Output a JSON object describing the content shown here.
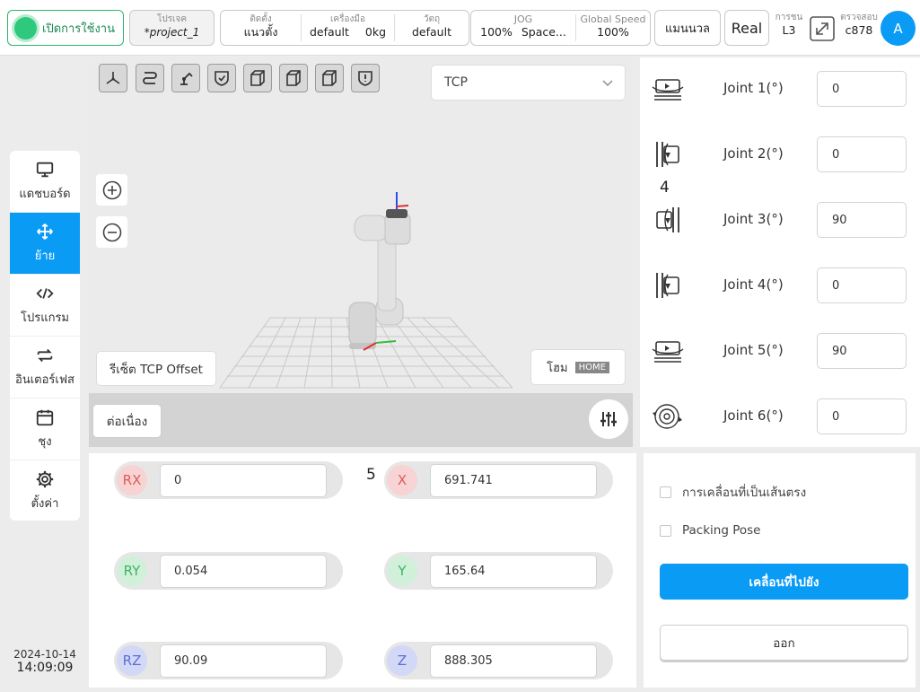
{
  "topbar": {
    "power_label": "เปิดการใช้งาน",
    "project": {
      "label": "โปรเจค",
      "value": "*project_1"
    },
    "install": {
      "mount_label": "ติดตั้ง",
      "mount_value": "แนวตั้ง",
      "tool_label": "เครื่องมือ",
      "tool_value": "default",
      "tool_weight": "0kg",
      "object_label": "วัตถุ",
      "object_value": "default"
    },
    "jog": {
      "jog_label": "JOG",
      "jog_percent": "100%",
      "jog_mode": "Space...",
      "speed_label": "Global Speed",
      "speed_value": "100%"
    },
    "manual_label": "แมนนวล",
    "real_label": "Real",
    "collision": {
      "label": "การชน",
      "value": "L3"
    },
    "check": {
      "label": "ตรวจสอบ",
      "value": "c878"
    },
    "avatar_letter": "A"
  },
  "nav": {
    "items": [
      {
        "label": "แดชบอร์ด",
        "icon": "monitor-icon",
        "active": false
      },
      {
        "label": "ย้าย",
        "icon": "move-icon",
        "active": true
      },
      {
        "label": "โปรแกรม",
        "icon": "code-icon",
        "active": false
      },
      {
        "label": "อินเตอร์เฟส",
        "icon": "swap-icon",
        "active": false
      },
      {
        "label": "ชุง",
        "icon": "calendar-icon",
        "active": false
      },
      {
        "label": "ตั้งค่า",
        "icon": "gear-icon",
        "active": false
      }
    ]
  },
  "clock": {
    "date": "2024-10-14",
    "time": "14:09:09"
  },
  "view": {
    "frame_select": "TCP",
    "reset_tcp_label": "รีเซ็ต TCP Offset",
    "home_label": "โฮม",
    "home_tag": "HOME",
    "continuous_label": "ต่อเนื่อง"
  },
  "joints": [
    {
      "label": "Joint 1(°)",
      "value": "0"
    },
    {
      "label": "Joint 2(°)",
      "value": "0"
    },
    {
      "label": "Joint 3(°)",
      "value": "90"
    },
    {
      "label": "Joint 4(°)",
      "value": "0"
    },
    {
      "label": "Joint 5(°)",
      "value": "90"
    },
    {
      "label": "Joint 6(°)",
      "value": "0"
    }
  ],
  "annotations": {
    "four": "4",
    "five": "5"
  },
  "coords": {
    "rx": {
      "label": "RX",
      "value": "0"
    },
    "ry": {
      "label": "RY",
      "value": "0.054"
    },
    "rz": {
      "label": "RZ",
      "value": "90.09"
    },
    "x": {
      "label": "X",
      "value": "691.741"
    },
    "y": {
      "label": "Y",
      "value": "165.64"
    },
    "z": {
      "label": "Z",
      "value": "888.305"
    }
  },
  "actions": {
    "linear_label": "การเคลื่อนที่เป็นเส้นตรง",
    "packing_label": "Packing Pose",
    "moveto_label": "เคลื่อนที่ไปยัง",
    "exit_label": "ออก"
  },
  "colors": {
    "accent": "#0a9bf5",
    "power_green": "#2ec97c"
  }
}
